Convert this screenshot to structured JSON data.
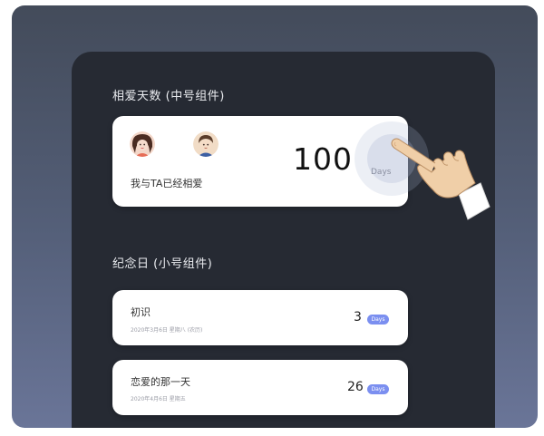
{
  "colors": {
    "background": "#555f78",
    "panel": "#262a33",
    "card": "#ffffff",
    "badge": "#7b8ff0"
  },
  "medium_widget": {
    "section_title": "相爱天数 (中号组件)",
    "subtitle": "我与TA已经相爱",
    "count": "100",
    "unit": "Days",
    "avatars": [
      "female-avatar-icon",
      "male-avatar-icon"
    ]
  },
  "small_widget": {
    "section_title": "纪念日 (小号组件)",
    "items": [
      {
        "title": "初识",
        "date": "2020年3月6日 星期八 (农历)",
        "count": "3",
        "unit": "Days"
      },
      {
        "title": "恋爱的那一天",
        "date": "2020年4月6日 星期五",
        "count": "26",
        "unit": "Days"
      }
    ]
  },
  "pointer": {
    "icon": "pointing-hand-icon"
  }
}
